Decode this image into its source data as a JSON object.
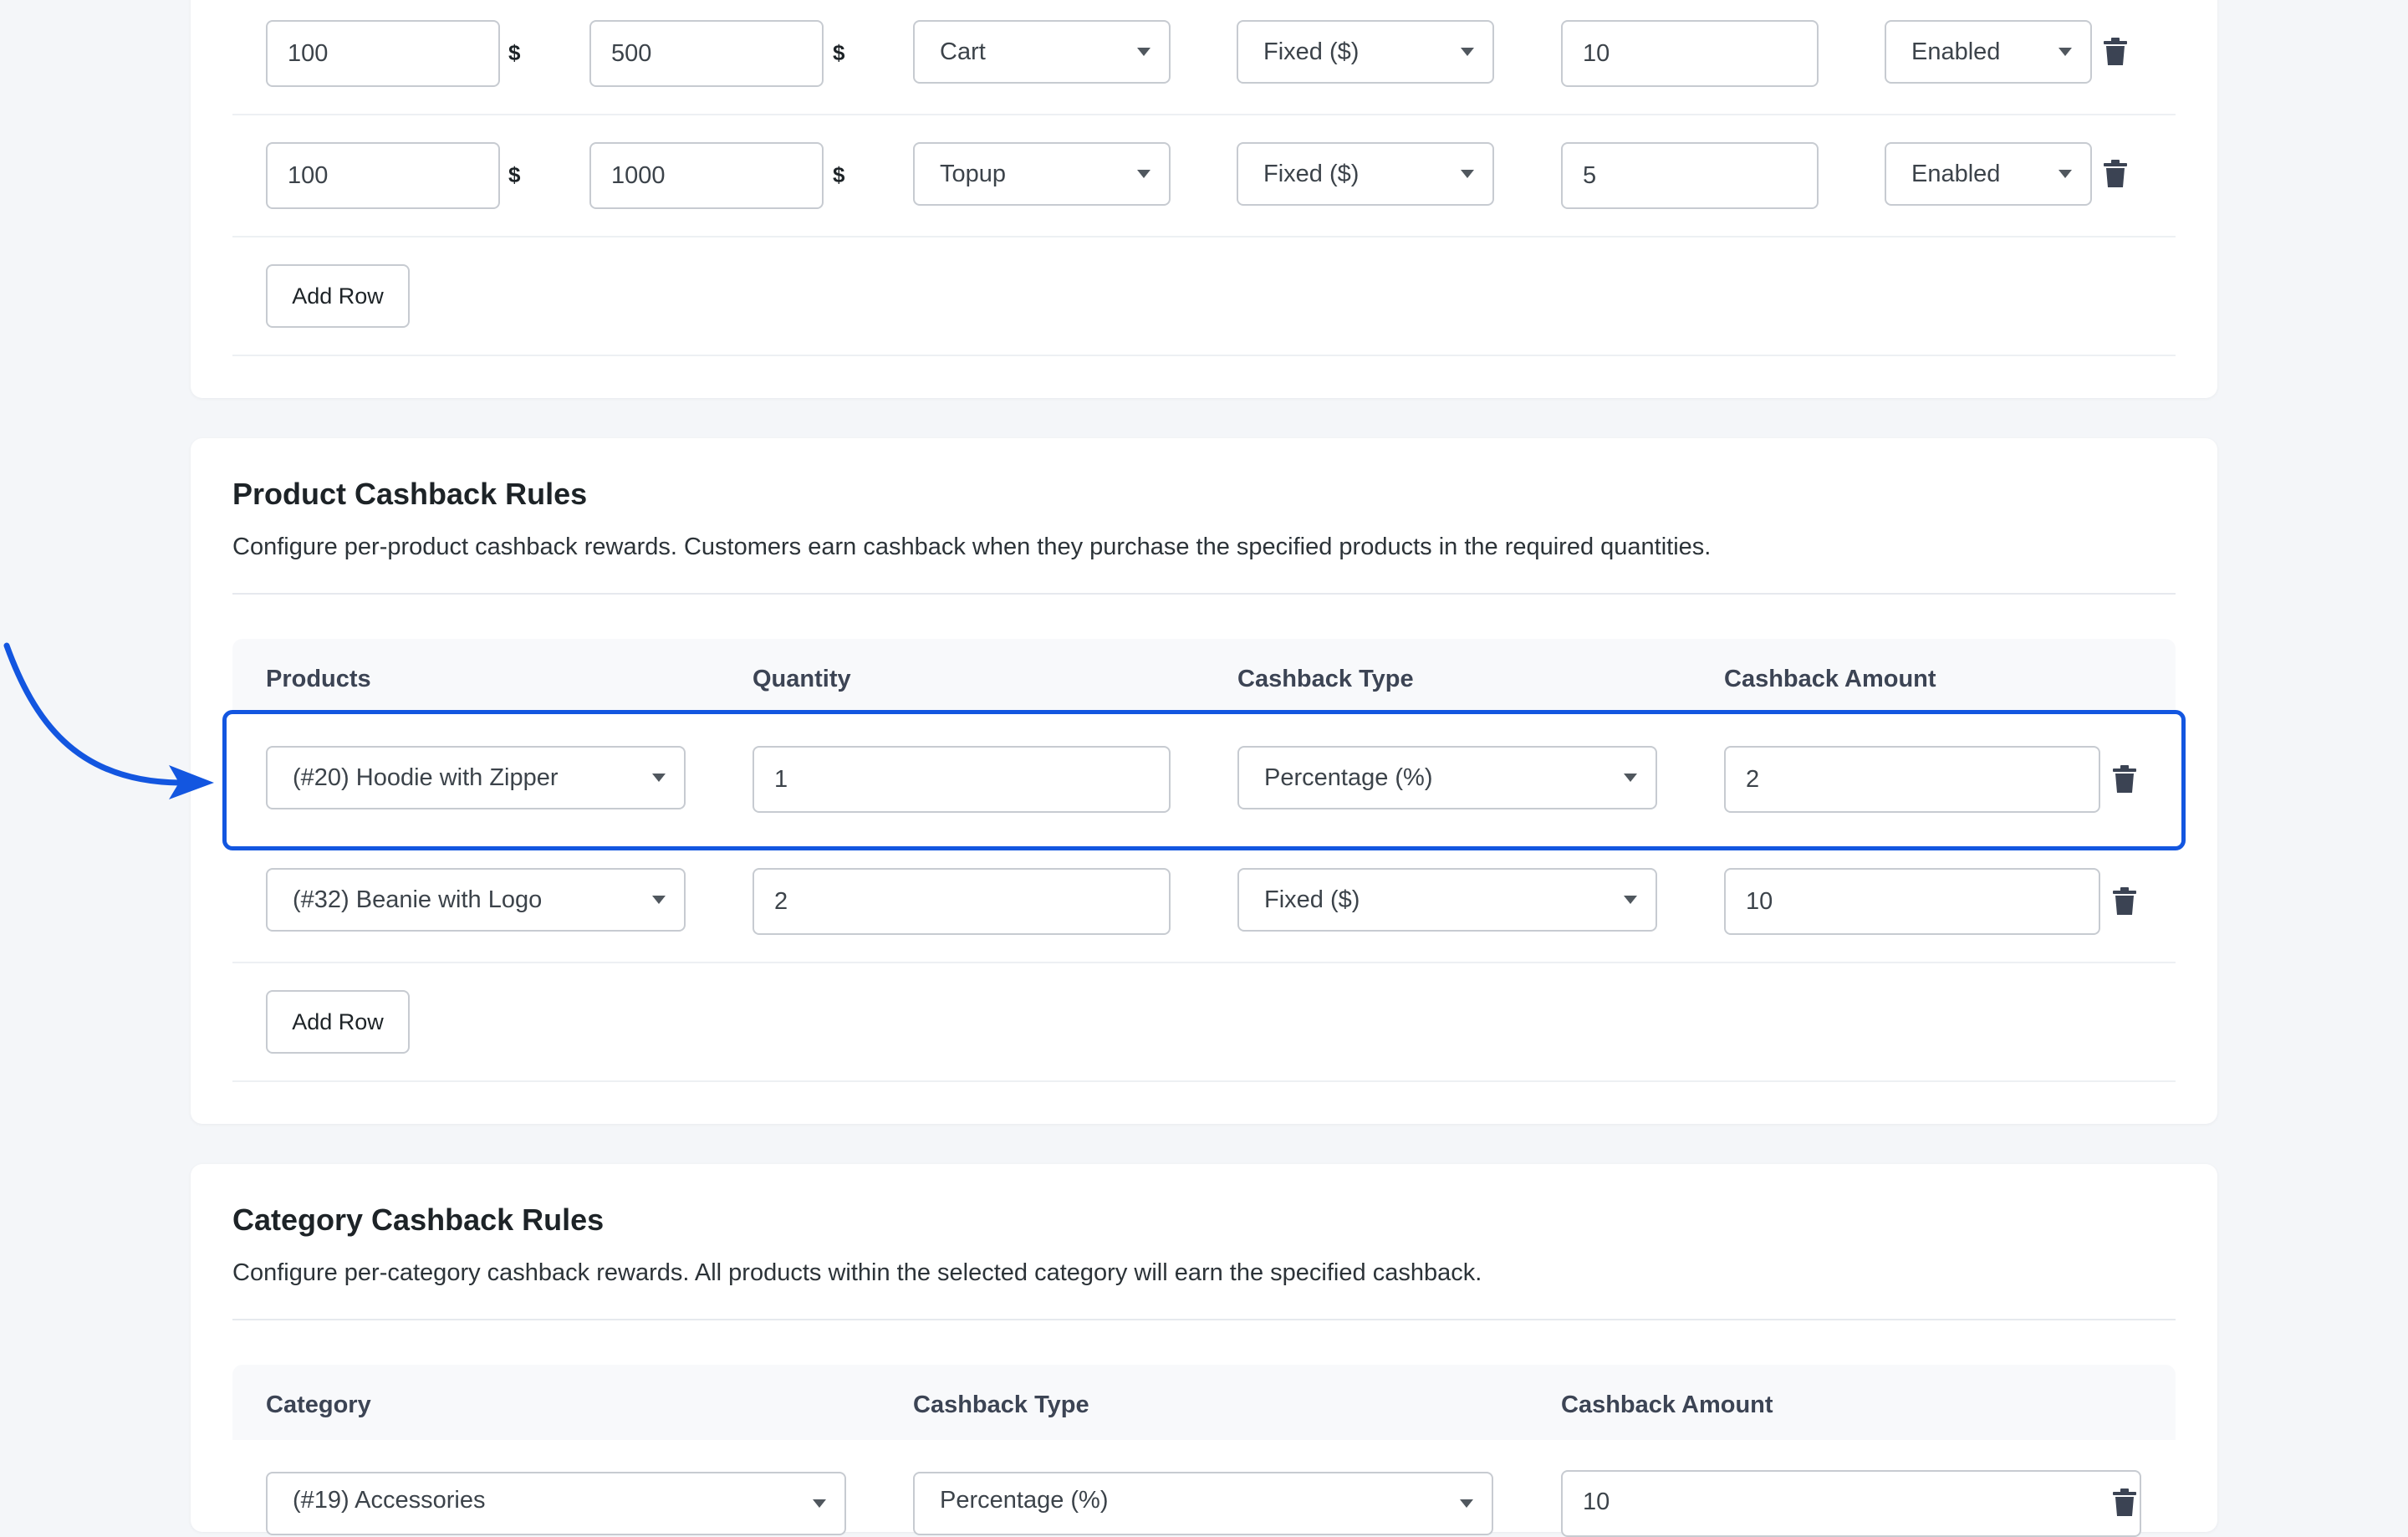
{
  "colors": {
    "highlight": "#1356e0",
    "background": "#f4f6f9",
    "card": "#ffffff"
  },
  "cart_rules": {
    "currency_symbol": "$",
    "rows": [
      {
        "min": "100",
        "max": "500",
        "type": "Cart",
        "cashback_type": "Fixed ($)",
        "amount": "10",
        "status": "Enabled"
      },
      {
        "min": "100",
        "max": "1000",
        "type": "Topup",
        "cashback_type": "Fixed ($)",
        "amount": "5",
        "status": "Enabled"
      }
    ],
    "add_row_label": "Add Row"
  },
  "product_rules": {
    "title": "Product Cashback Rules",
    "description": "Configure per-product cashback rewards. Customers earn cashback when they purchase the specified products in the required quantities.",
    "headers": [
      "Products",
      "Quantity",
      "Cashback Type",
      "Cashback Amount"
    ],
    "rows": [
      {
        "product": "(#20) Hoodie with Zipper",
        "quantity": "1",
        "cashback_type": "Percentage (%)",
        "amount": "2",
        "highlighted": true
      },
      {
        "product": "(#32) Beanie with Logo",
        "quantity": "2",
        "cashback_type": "Fixed ($)",
        "amount": "10",
        "highlighted": false
      }
    ],
    "add_row_label": "Add Row"
  },
  "category_rules": {
    "title": "Category Cashback Rules",
    "description": "Configure per-category cashback rewards. All products within the selected category will earn the specified cashback.",
    "headers": [
      "Category",
      "Cashback Type",
      "Cashback Amount"
    ],
    "rows": [
      {
        "category": "(#19) Accessories",
        "cashback_type": "Percentage (%)",
        "amount": "10"
      }
    ]
  },
  "icons": {
    "delete": "trash-icon",
    "dropdown": "caret-down-icon",
    "annotation": "curved-arrow-icon"
  }
}
